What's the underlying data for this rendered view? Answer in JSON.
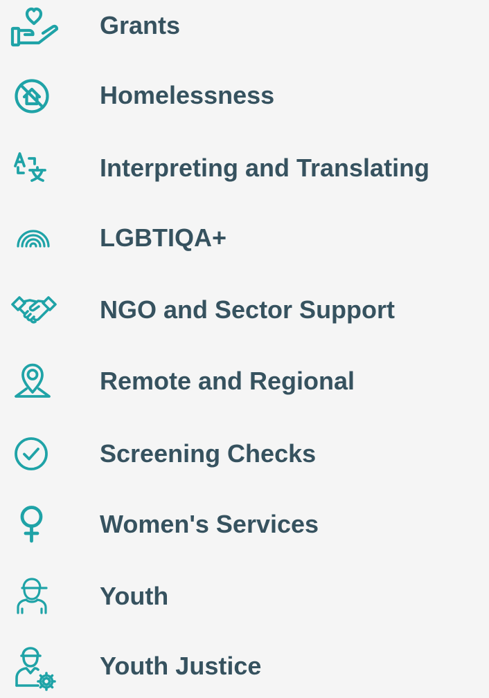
{
  "colors": {
    "background": "#f5f5f5",
    "icon": "#1fa3a7",
    "text": "#36525f"
  },
  "categories": [
    {
      "label": "Grants",
      "icon": "hand-heart-icon"
    },
    {
      "label": "Homelessness",
      "icon": "no-home-icon"
    },
    {
      "label": "Interpreting and Translating",
      "icon": "translate-icon"
    },
    {
      "label": "LGBTIQA+",
      "icon": "rainbow-icon"
    },
    {
      "label": "NGO and Sector Support",
      "icon": "handshake-icon"
    },
    {
      "label": "Remote and Regional",
      "icon": "location-pin-icon"
    },
    {
      "label": "Screening Checks",
      "icon": "check-circle-icon"
    },
    {
      "label": "Women's Services",
      "icon": "female-symbol-icon"
    },
    {
      "label": "Youth",
      "icon": "young-person-icon"
    },
    {
      "label": "Youth Justice",
      "icon": "youth-justice-icon"
    }
  ]
}
